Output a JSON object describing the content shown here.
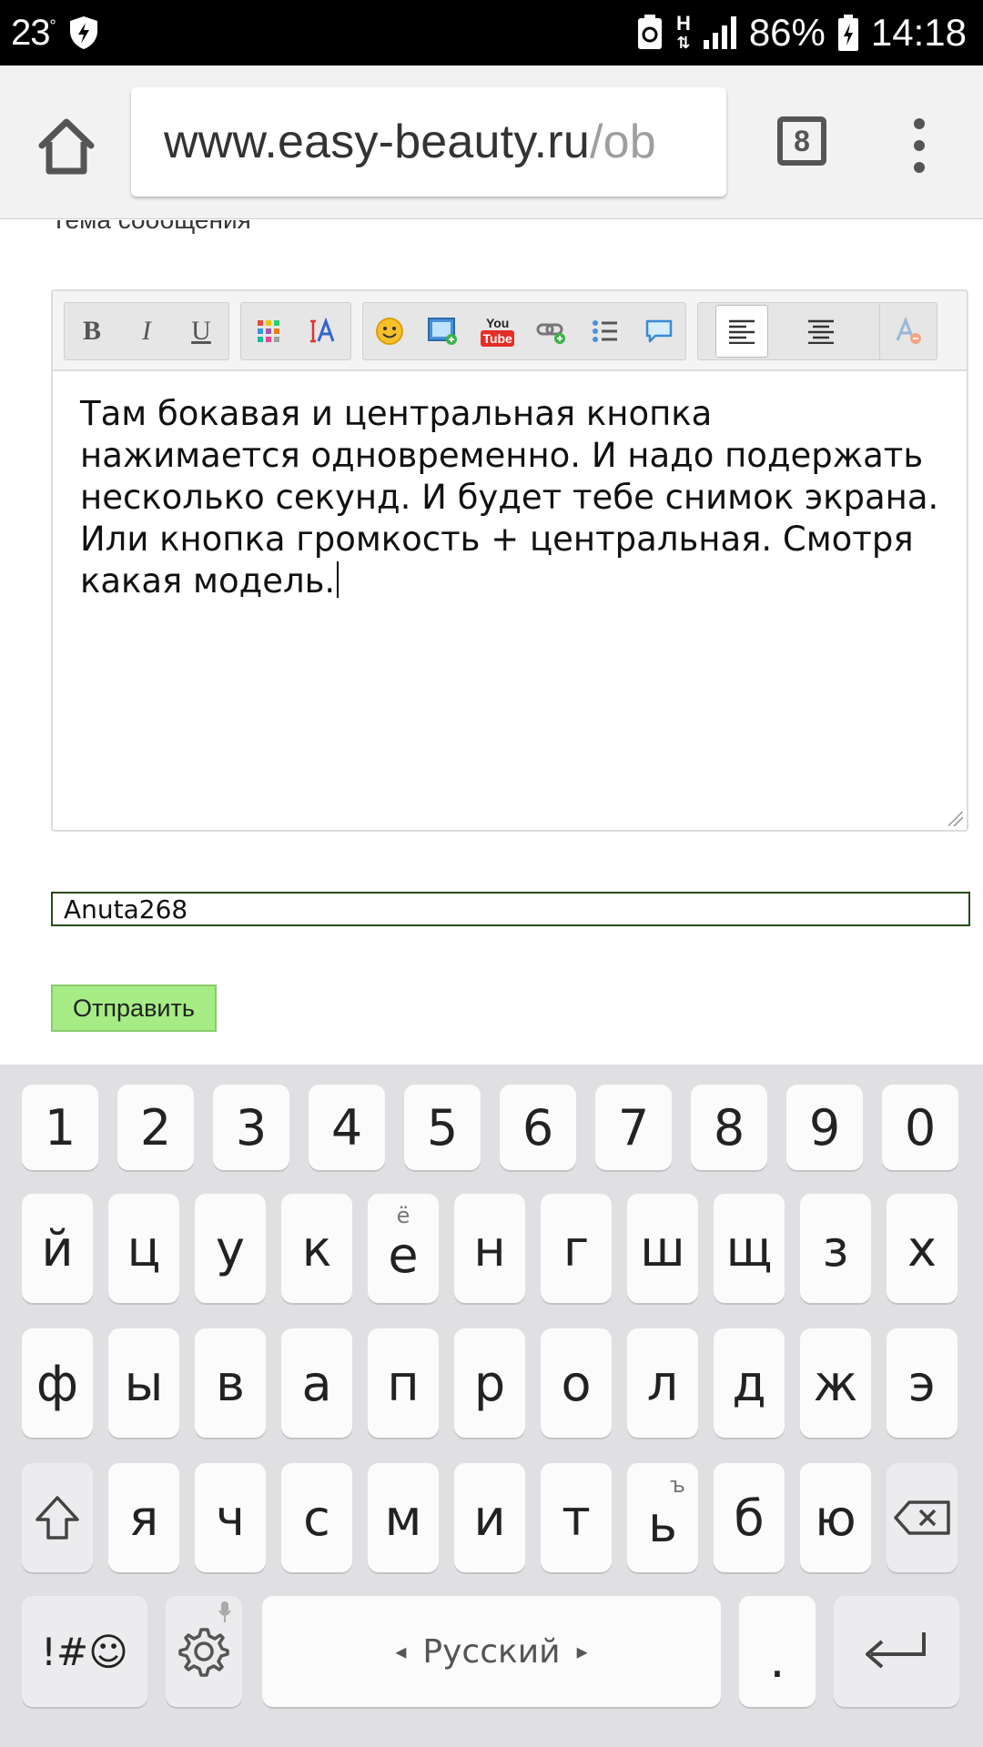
{
  "status_bar": {
    "temperature": "23",
    "temp_unit": "°",
    "network_type": "H",
    "battery_percent": "86%",
    "time": "14:18"
  },
  "browser": {
    "url_main": "www.easy-beauty.ru",
    "url_rest": "/ob",
    "tab_count": "8"
  },
  "page": {
    "cut_label": "Тема сообщения",
    "editor_text": "Там бокавая и центральная кнопка нажимается одновременно. И надо подержать несколько секунд. И будет тебе снимок экрана. Или кнопка громкость + центральная. Смотря какая модель.",
    "name_value": "Anuta268",
    "send_label": "Отправить"
  },
  "editor_toolbar": {
    "bold": "B",
    "italic": "I",
    "underline": "U",
    "youtube_top": "You",
    "youtube_bottom": "Tube"
  },
  "keyboard": {
    "numbers": [
      "1",
      "2",
      "3",
      "4",
      "5",
      "6",
      "7",
      "8",
      "9",
      "0"
    ],
    "row1": [
      "й",
      "ц",
      "у",
      "к",
      "е",
      "н",
      "г",
      "ш",
      "щ",
      "з",
      "х"
    ],
    "row1_alt_e": "ё",
    "row2": [
      "ф",
      "ы",
      "в",
      "а",
      "п",
      "р",
      "о",
      "л",
      "д",
      "ж",
      "э"
    ],
    "row3": [
      "я",
      "ч",
      "с",
      "м",
      "и",
      "т",
      "ь",
      "б",
      "ю"
    ],
    "row3_alt_soft": "ъ",
    "symbols_key": "!#☺",
    "language": "Русский",
    "period": "."
  }
}
